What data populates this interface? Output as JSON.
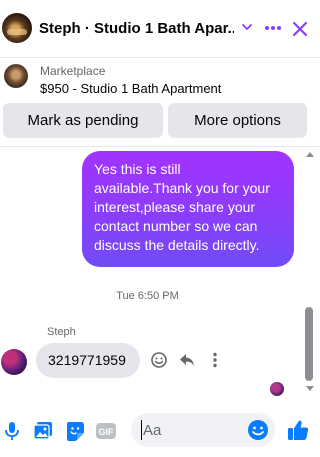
{
  "header": {
    "title": "Steph · Studio 1 Bath Apar...",
    "icons": [
      "avatar",
      "chevron-down-icon",
      "more-icon",
      "close-icon"
    ]
  },
  "listing": {
    "source": "Marketplace",
    "title": "$950 - Studio 1 Bath Apartment"
  },
  "actions": {
    "mark_pending": "Mark as pending",
    "more_options": "More options"
  },
  "messages": {
    "outgoing": "Yes this is still available.Thank you for your interest,please share your contact number so we can discuss the details directly.",
    "timestamp": "Tue 6:50 PM",
    "sender_name": "Steph",
    "incoming": "3219771959"
  },
  "composer": {
    "placeholder": "Aa",
    "icons": [
      "microphone-icon",
      "photo-icon",
      "sticker-icon",
      "gif-icon",
      "emoji-icon",
      "like-icon"
    ],
    "gif_label": "GIF"
  },
  "colors": {
    "accent": "#8a3ffc",
    "brand_blue": "#0a7cff",
    "bubble_gradient_top": "#a133ff",
    "bubble_gradient_bottom": "#6f4cf6"
  }
}
